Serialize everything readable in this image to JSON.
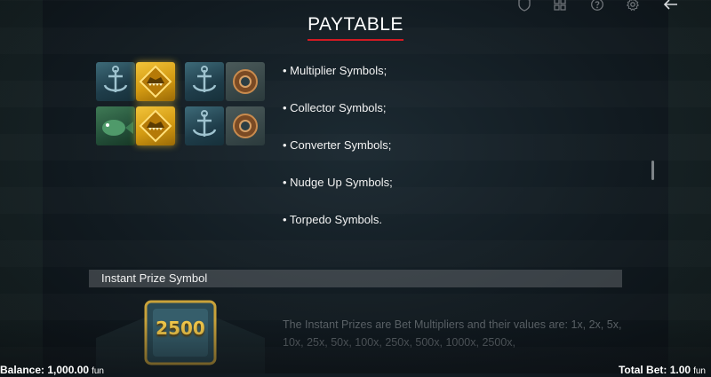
{
  "header": {
    "title": "PAYTABLE",
    "accent_color": "#d21a22",
    "icons": [
      "shield-icon",
      "grid-icon",
      "help-icon",
      "settings-icon",
      "back-arrow-icon"
    ]
  },
  "feature_symbols": {
    "reel_icons": [
      "anchor",
      "gold-shark-symbol",
      "anchor",
      "diving-helmet",
      "fish",
      "gold-shark-symbol",
      "anchor",
      "diving-helmet"
    ],
    "items": [
      "• Multiplier Symbols;",
      "• Collector Symbols;",
      "• Converter Symbols;",
      "• Nudge Up Symbols;",
      "• Torpedo Symbols."
    ]
  },
  "instant_prize": {
    "header": "Instant Prize Symbol",
    "badge_value": "2500",
    "description": "The Instant Prizes are Bet Multipliers and their values are: 1x, 2x, 5x, 10x, 25x, 50x, 100x, 250x, 500x, 1000x, 2500x,"
  },
  "footer": {
    "balance_label": "Balance: 1,000.00",
    "balance_currency": "fun",
    "total_bet_label": "Total Bet: 1.00",
    "total_bet_currency": "fun"
  }
}
